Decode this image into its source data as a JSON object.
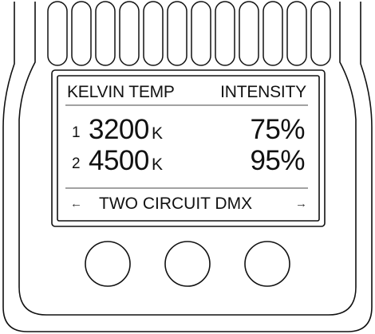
{
  "screen": {
    "header_left": "KELVIN TEMP",
    "header_right": "INTENSITY",
    "circuits": [
      {
        "index": "1",
        "kelvin": "3200",
        "unit": "K",
        "intensity": "75%"
      },
      {
        "index": "2",
        "kelvin": "4500",
        "unit": "K",
        "intensity": "95%"
      }
    ],
    "nav_left_icon": "arrow-left",
    "nav_right_icon": "arrow-right",
    "nav_left_glyph": "←",
    "nav_right_glyph": "→",
    "mode_label": "TWO CIRCUIT DMX"
  },
  "buttons": [
    {
      "name": "left-knob"
    },
    {
      "name": "center-knob"
    },
    {
      "name": "right-knob"
    }
  ],
  "colors": {
    "outline": "#111111",
    "lcd_background": "#ffffff",
    "device_background": "#ffffff"
  }
}
